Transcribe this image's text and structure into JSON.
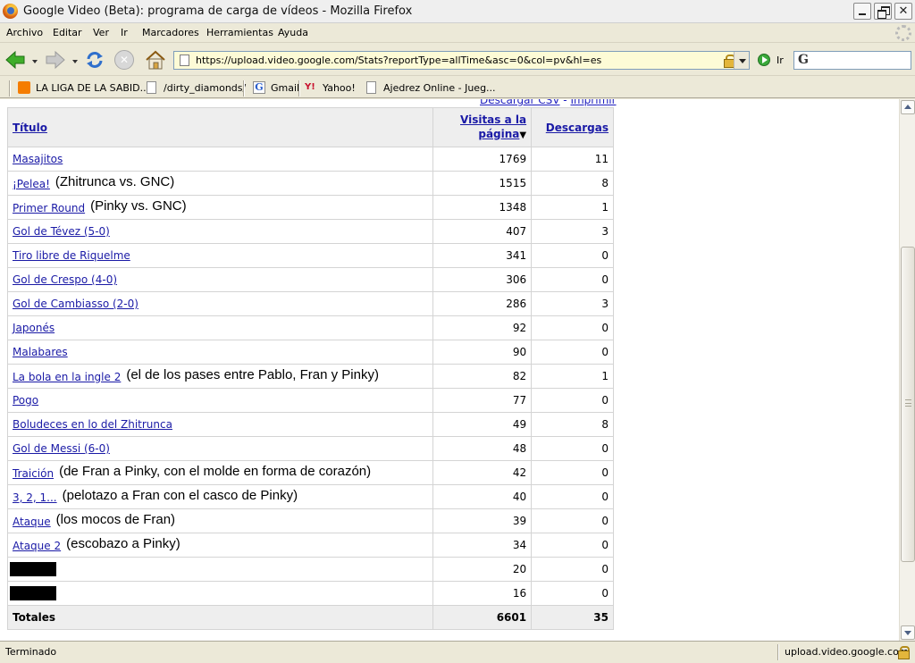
{
  "window": {
    "title": "Google Video (Beta): programa de carga de vídeos - Mozilla Firefox"
  },
  "menu": [
    "Archivo",
    "Editar",
    "Ver",
    "Ir",
    "Marcadores",
    "Herramientas",
    "Ayuda"
  ],
  "nav": {
    "url": "https://upload.video.google.com/Stats?reportType=allTime&asc=0&col=pv&hl=es",
    "go_label": "Ir",
    "search_placeholder": ""
  },
  "bookmarks": [
    {
      "label": "LA LIGA DE LA SABID...",
      "icon": "blogger-icon"
    },
    {
      "label": "/dirty_diamonds/",
      "icon": "page-icon"
    },
    {
      "label": "Gmail",
      "icon": "google-icon"
    },
    {
      "label": "Yahoo!",
      "icon": "yahoo-icon"
    },
    {
      "label": "Ajedrez Online - Jueg...",
      "icon": "page-icon"
    }
  ],
  "page": {
    "top_links": {
      "csv": "Descargar CSV",
      "sep": " - ",
      "print": "Imprimir"
    },
    "table": {
      "headers": {
        "title": "Título",
        "views_line1": "Visitas a la",
        "views_line2": "página",
        "downloads": "Descargas",
        "sort_indicator": "▼"
      },
      "rows": [
        {
          "title": "Masajitos",
          "note": "",
          "views": "1769",
          "downloads": "11",
          "redacted": false
        },
        {
          "title": "¡Pelea!",
          "note": "(Zhitrunca vs. GNC)",
          "views": "1515",
          "downloads": "8",
          "redacted": false
        },
        {
          "title": "Primer Round",
          "note": "(Pinky vs. GNC)",
          "views": "1348",
          "downloads": "1",
          "redacted": false
        },
        {
          "title": "Gol de Tévez (5-0)",
          "note": "",
          "views": "407",
          "downloads": "3",
          "redacted": false
        },
        {
          "title": "Tiro libre de Riquelme",
          "note": "",
          "views": "341",
          "downloads": "0",
          "redacted": false
        },
        {
          "title": "Gol de Crespo (4-0)",
          "note": "",
          "views": "306",
          "downloads": "0",
          "redacted": false
        },
        {
          "title": "Gol de Cambiasso (2-0)",
          "note": "",
          "views": "286",
          "downloads": "3",
          "redacted": false
        },
        {
          "title": "Japonés",
          "note": "",
          "views": "92",
          "downloads": "0",
          "redacted": false
        },
        {
          "title": "Malabares",
          "note": "",
          "views": "90",
          "downloads": "0",
          "redacted": false
        },
        {
          "title": "La bola en la ingle 2",
          "note": "(el de los pases entre Pablo, Fran y Pinky)",
          "views": "82",
          "downloads": "1",
          "redacted": false
        },
        {
          "title": "Pogo",
          "note": "",
          "views": "77",
          "downloads": "0",
          "redacted": false
        },
        {
          "title": "Boludeces en lo del Zhitrunca",
          "note": "",
          "views": "49",
          "downloads": "8",
          "redacted": false
        },
        {
          "title": "Gol de Messi (6-0)",
          "note": "",
          "views": "48",
          "downloads": "0",
          "redacted": false
        },
        {
          "title": "Traición",
          "note": "(de Fran a Pinky, con el molde en forma de corazón)",
          "views": "42",
          "downloads": "0",
          "redacted": false
        },
        {
          "title": "3, 2, 1...",
          "note": "(pelotazo a Fran con el casco de Pinky)",
          "views": "40",
          "downloads": "0",
          "redacted": false
        },
        {
          "title": "Ataque",
          "note": "(los mocos de Fran)",
          "views": "39",
          "downloads": "0",
          "redacted": false
        },
        {
          "title": "Ataque 2",
          "note": "(escobazo a Pinky)",
          "views": "34",
          "downloads": "0",
          "redacted": false
        },
        {
          "title": "",
          "note": "",
          "views": "20",
          "downloads": "0",
          "redacted": true
        },
        {
          "title": "",
          "note": "",
          "views": "16",
          "downloads": "0",
          "redacted": true
        }
      ],
      "totals": {
        "label": "Totales",
        "views": "6601",
        "downloads": "35"
      }
    }
  },
  "status": {
    "text": "Terminado",
    "host": "upload.video.google.com"
  }
}
